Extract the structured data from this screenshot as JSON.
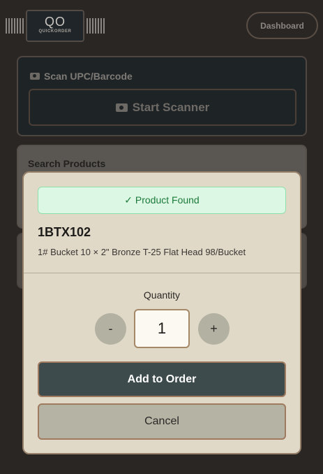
{
  "header": {
    "logo_text": "QO",
    "logo_subtext": "QUICKORDER",
    "dashboard_label": "Dashboard"
  },
  "scan": {
    "title": "Scan UPC/Barcode",
    "start_label": "Start Scanner",
    "icon": "camera-icon"
  },
  "search": {
    "title": "Search Products"
  },
  "modal": {
    "status": "✓ Product Found",
    "sku": "1BTX102",
    "description": "1# Bucket 10 × 2\" Bronze T-25 Flat Head 98/Bucket",
    "quantity_label": "Quantity",
    "quantity_value": "1",
    "minus_label": "-",
    "plus_label": "+",
    "add_label": "Add to Order",
    "cancel_label": "Cancel"
  },
  "colors": {
    "background": "#2a2624",
    "modal_bg": "#e0d9c8",
    "success_bg": "#dcf7e4",
    "success_text": "#1c7a3a",
    "primary_button": "#3e4b4c",
    "accent_border": "#a07a5e"
  }
}
